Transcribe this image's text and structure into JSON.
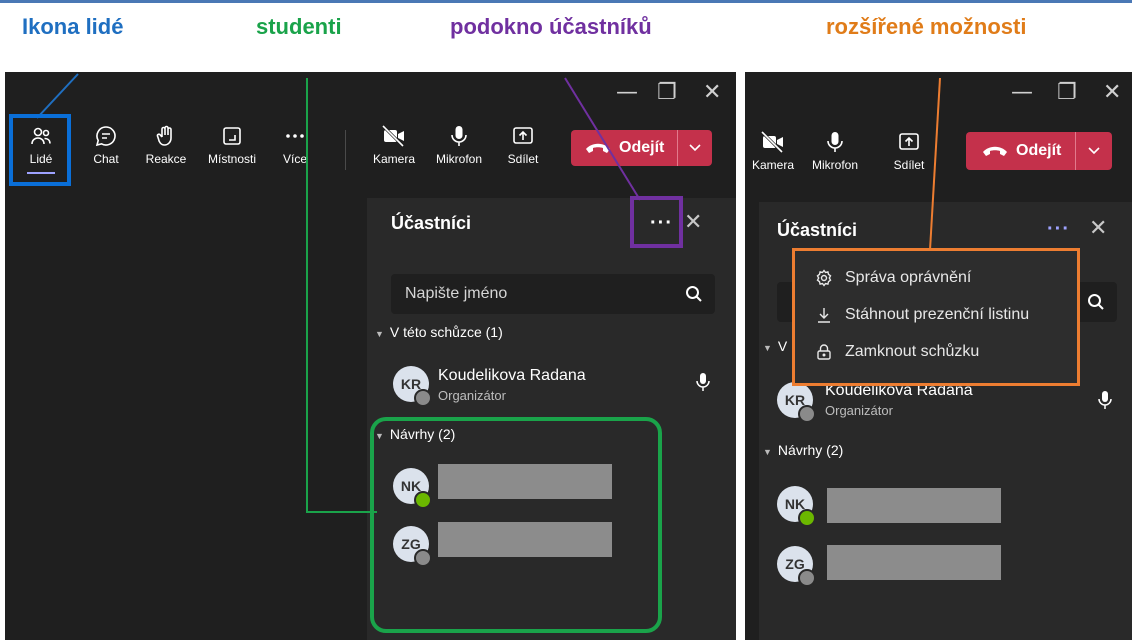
{
  "callouts": {
    "people_icon": "Ikona lidé",
    "students": "studenti",
    "participants_pane": "podokno účastníků",
    "more_options": "rozšířené možnosti"
  },
  "colors": {
    "blue": "#1f6fc1",
    "green": "#1aa34a",
    "purple": "#7030a0",
    "orange": "#e07c19",
    "leave_red": "#c4314b",
    "panel_bg": "#292929",
    "window_bg": "#1f1f1f"
  },
  "toolbar": {
    "people": "Lidé",
    "chat": "Chat",
    "reactions": "Reakce",
    "rooms": "Místnosti",
    "more": "Více",
    "camera": "Kamera",
    "mic": "Mikrofon",
    "share": "Sdílet",
    "leave": "Odejít"
  },
  "panel": {
    "title": "Účastníci",
    "search_placeholder": "Napište jméno",
    "in_meeting_header": "V této schůzce (1)",
    "suggestions_header": "Návrhy (2)",
    "organizer": {
      "initials": "KR",
      "name": "Koudelikova Radana",
      "role": "Organizátor"
    },
    "suggested": [
      {
        "initials": "NK"
      },
      {
        "initials": "ZG"
      }
    ]
  },
  "menu": {
    "items": [
      "Správa oprávnění",
      "Stáhnout prezenční listinu",
      "Zamknout schůzku"
    ]
  },
  "right_partial": {
    "section_initial": "V"
  }
}
